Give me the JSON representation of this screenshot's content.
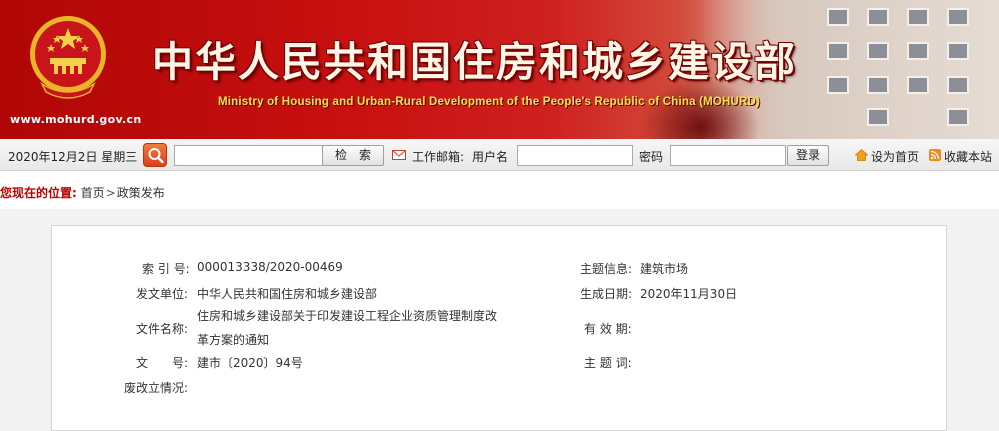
{
  "header": {
    "title_cn": "中华人民共和国住房和城乡建设部",
    "title_en": "Ministry of Housing and Urban-Rural Development of the People's Republic of China (MOHURD)",
    "site_url": "www.mohurd.gov.cn"
  },
  "toolbar": {
    "date": "2020年12月2日 星期三",
    "search_placeholder": "",
    "search_button": "检　索",
    "mailbox_label": "工作邮箱:",
    "username_label": "用户名",
    "password_label": "密码",
    "login_button": "登录",
    "set_homepage": "设为首页",
    "bookmark": "收藏本站"
  },
  "breadcrumb": {
    "label": "您现在的位置:",
    "items": [
      "首页",
      "政策发布"
    ],
    "separator": ">"
  },
  "info": {
    "index_label": "索 引 号:",
    "index_value": "000013338/2020-00469",
    "subject_label": "主题信息:",
    "subject_value": "建筑市场",
    "issuer_label": "发文单位:",
    "issuer_value": "中华人民共和国住房和城乡建设部",
    "date_label": "生成日期:",
    "date_value": "2020年11月30日",
    "filename_label": "文件名称:",
    "filename_line1": "住房和城乡建设部关于印发建设工程企业资质管理制度改",
    "filename_line2": "革方案的通知",
    "validity_label": "有 效 期:",
    "validity_value": "",
    "docno_label": "文　　号:",
    "docno_value": "建市〔2020〕94号",
    "keywords_label": "主 题 词:",
    "keywords_value": "",
    "status_label": "废改立情况:",
    "status_value": ""
  },
  "colors": {
    "banner_red": "#c81010",
    "title_en_yellow": "#f4e24a",
    "crumb_label_red": "#c00000",
    "search_orange": "#e45a26"
  }
}
